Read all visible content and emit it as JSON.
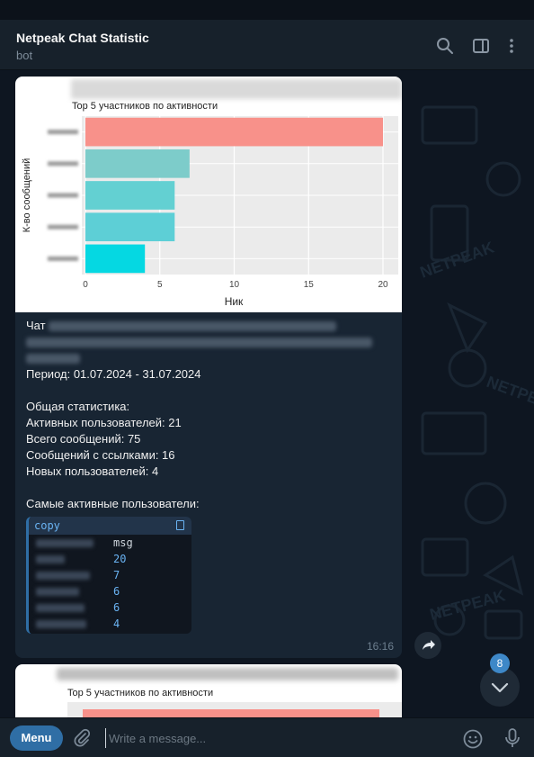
{
  "header": {
    "title": "Netpeak Chat Statistic",
    "subtitle": "bot"
  },
  "message": {
    "chart_data": {
      "type": "bar",
      "orientation": "horizontal",
      "title": "Top 5 участников по активности",
      "xlabel": "Ник",
      "ylabel": "К-во сообщений",
      "x_ticks": [
        "0",
        "5",
        "10",
        "15",
        "20"
      ],
      "xlim": [
        0,
        21
      ],
      "values": [
        20,
        7,
        6,
        6,
        4
      ],
      "colors": [
        "#f8918a",
        "#7dccca",
        "#63d0d2",
        "#5dcfd6",
        "#05d8e2"
      ],
      "grid": true
    },
    "chat_label": "Чат",
    "period": "Период: 01.07.2024 - 31.07.2024",
    "stats_title": "Общая статистика:",
    "active_users": "Активных пользователей: 21",
    "total_messages": "Всего сообщений: 75",
    "link_messages": "Сообщений с ссылками: 16",
    "new_users": "Новых пользователей: 4",
    "top_title": "Самые активные пользователи:",
    "code": {
      "lang": "copy",
      "header_col": "msg",
      "values": [
        "20",
        "7",
        "6",
        "6",
        "4"
      ]
    },
    "time": "16:16"
  },
  "message2": {
    "chart_title": "Top 5 участников по активности"
  },
  "unread_badge": "8",
  "composer": {
    "menu_label": "Menu",
    "placeholder": "Write a message..."
  }
}
